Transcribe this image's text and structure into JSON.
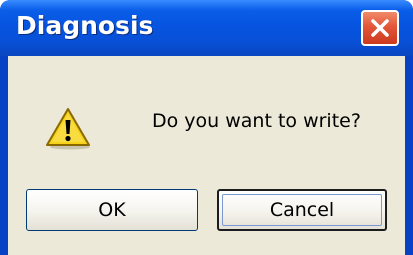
{
  "dialog": {
    "title": "Diagnosis",
    "message": "Do you want to write?",
    "icon": "warning-icon",
    "close_icon": "close-icon"
  },
  "buttons": {
    "ok_label": "OK",
    "cancel_label": "Cancel"
  },
  "colors": {
    "titlebar": "#0654e0",
    "close_button": "#e2563a",
    "client_background": "#ece9d8",
    "warning_yellow": "#f6d21a"
  }
}
